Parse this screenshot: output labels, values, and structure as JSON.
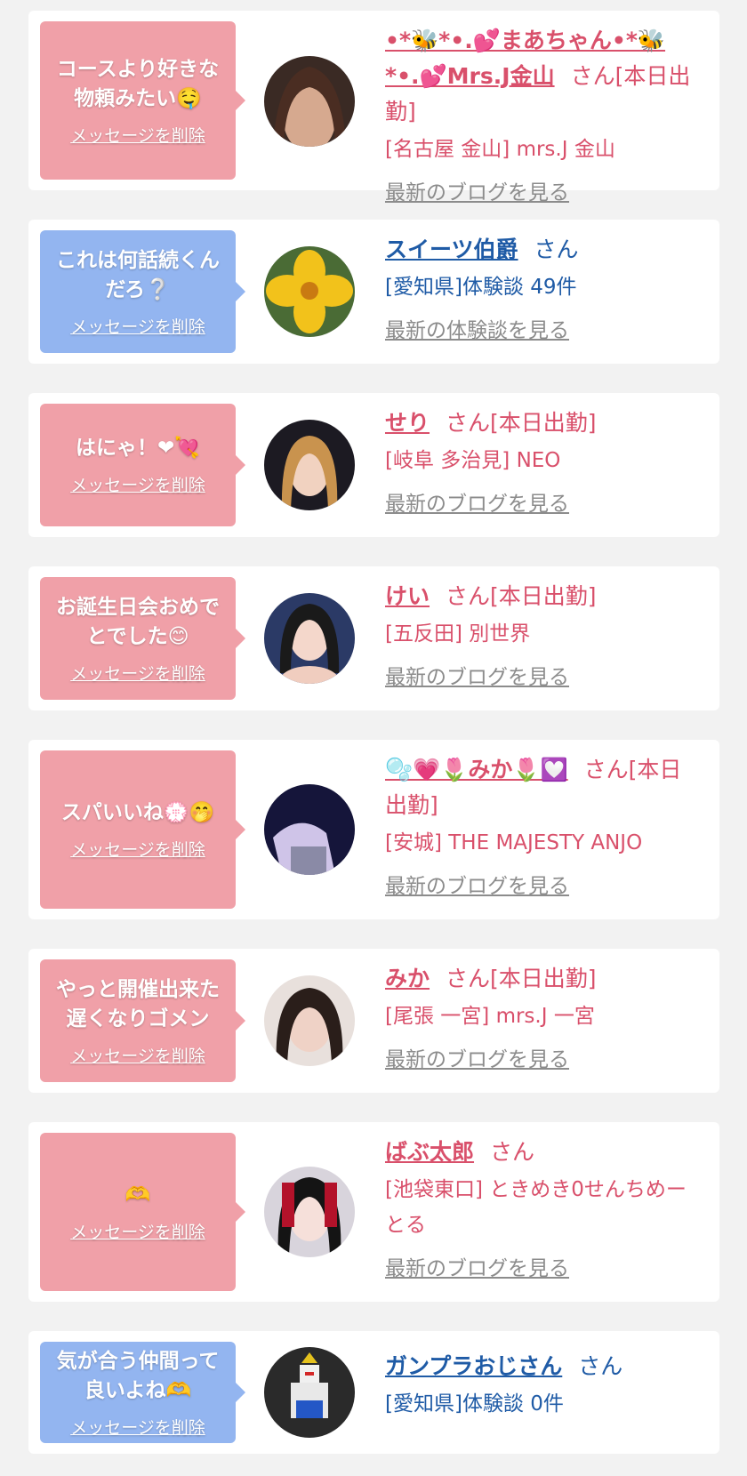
{
  "items": [
    {
      "bubble_text": "コースより好きな物頼みたい🤤",
      "delete_label": "メッセージを削除",
      "name": "•*🐝*•.💕まあちゃん•*🐝*•.💕Mrs.J金山",
      "honorific": "さん[本日出勤]",
      "shop": "[名古屋 金山] mrs.J 金山",
      "link": "最新のブログを見る",
      "type": "pink"
    },
    {
      "bubble_text": "これは何話続くんだろ❔",
      "delete_label": "メッセージを削除",
      "name": "スイーツ伯爵",
      "honorific": "さん",
      "shop": "[愛知県]体験談 49件",
      "link": "最新の体験談を見る",
      "type": "blue"
    },
    {
      "bubble_text": "はにゃ！❤💘",
      "delete_label": "メッセージを削除",
      "name": "せり",
      "honorific": "さん[本日出勤]",
      "shop": "[岐阜 多治見] NEO",
      "link": "最新のブログを見る",
      "type": "pink"
    },
    {
      "bubble_text": "お誕生日会おめでとでした😊",
      "delete_label": "メッセージを削除",
      "name": "けい",
      "honorific": "さん[本日出勤]",
      "shop": "[五反田] 別世界",
      "link": "最新のブログを見る",
      "type": "pink"
    },
    {
      "bubble_text": "スパいいね💮🤭",
      "delete_label": "メッセージを削除",
      "name": "🫧💗🌷みか🌷💟",
      "honorific": "さん[本日出勤]",
      "shop": "[安城] THE MAJESTY ANJO",
      "link": "最新のブログを見る",
      "type": "pink"
    },
    {
      "bubble_text": "やっと開催出来た遅くなりゴメン",
      "delete_label": "メッセージを削除",
      "name": "みか",
      "honorific": "さん[本日出勤]",
      "shop": "[尾張 一宮] mrs.J 一宮",
      "link": "最新のブログを見る",
      "type": "pink"
    },
    {
      "bubble_text": "🫶",
      "delete_label": "メッセージを削除",
      "name": "ばぶ太郎",
      "honorific": "さん",
      "shop": "[池袋東口] ときめき0せんちめーとる",
      "link": "最新のブログを見る",
      "type": "pink"
    },
    {
      "bubble_text": "気が合う仲間って良いよね🫶",
      "delete_label": "メッセージを削除",
      "name": "ガンプラおじさん",
      "honorific": "さん",
      "shop": "[愛知県]体験談 0件",
      "link": "",
      "type": "blue"
    }
  ],
  "colors": {
    "pink_bubble": "#f0a0a8",
    "blue_bubble": "#93b5f0",
    "pink_text": "#d9506b",
    "blue_text": "#1f5ba6",
    "link_gray": "#8c8c8c"
  }
}
